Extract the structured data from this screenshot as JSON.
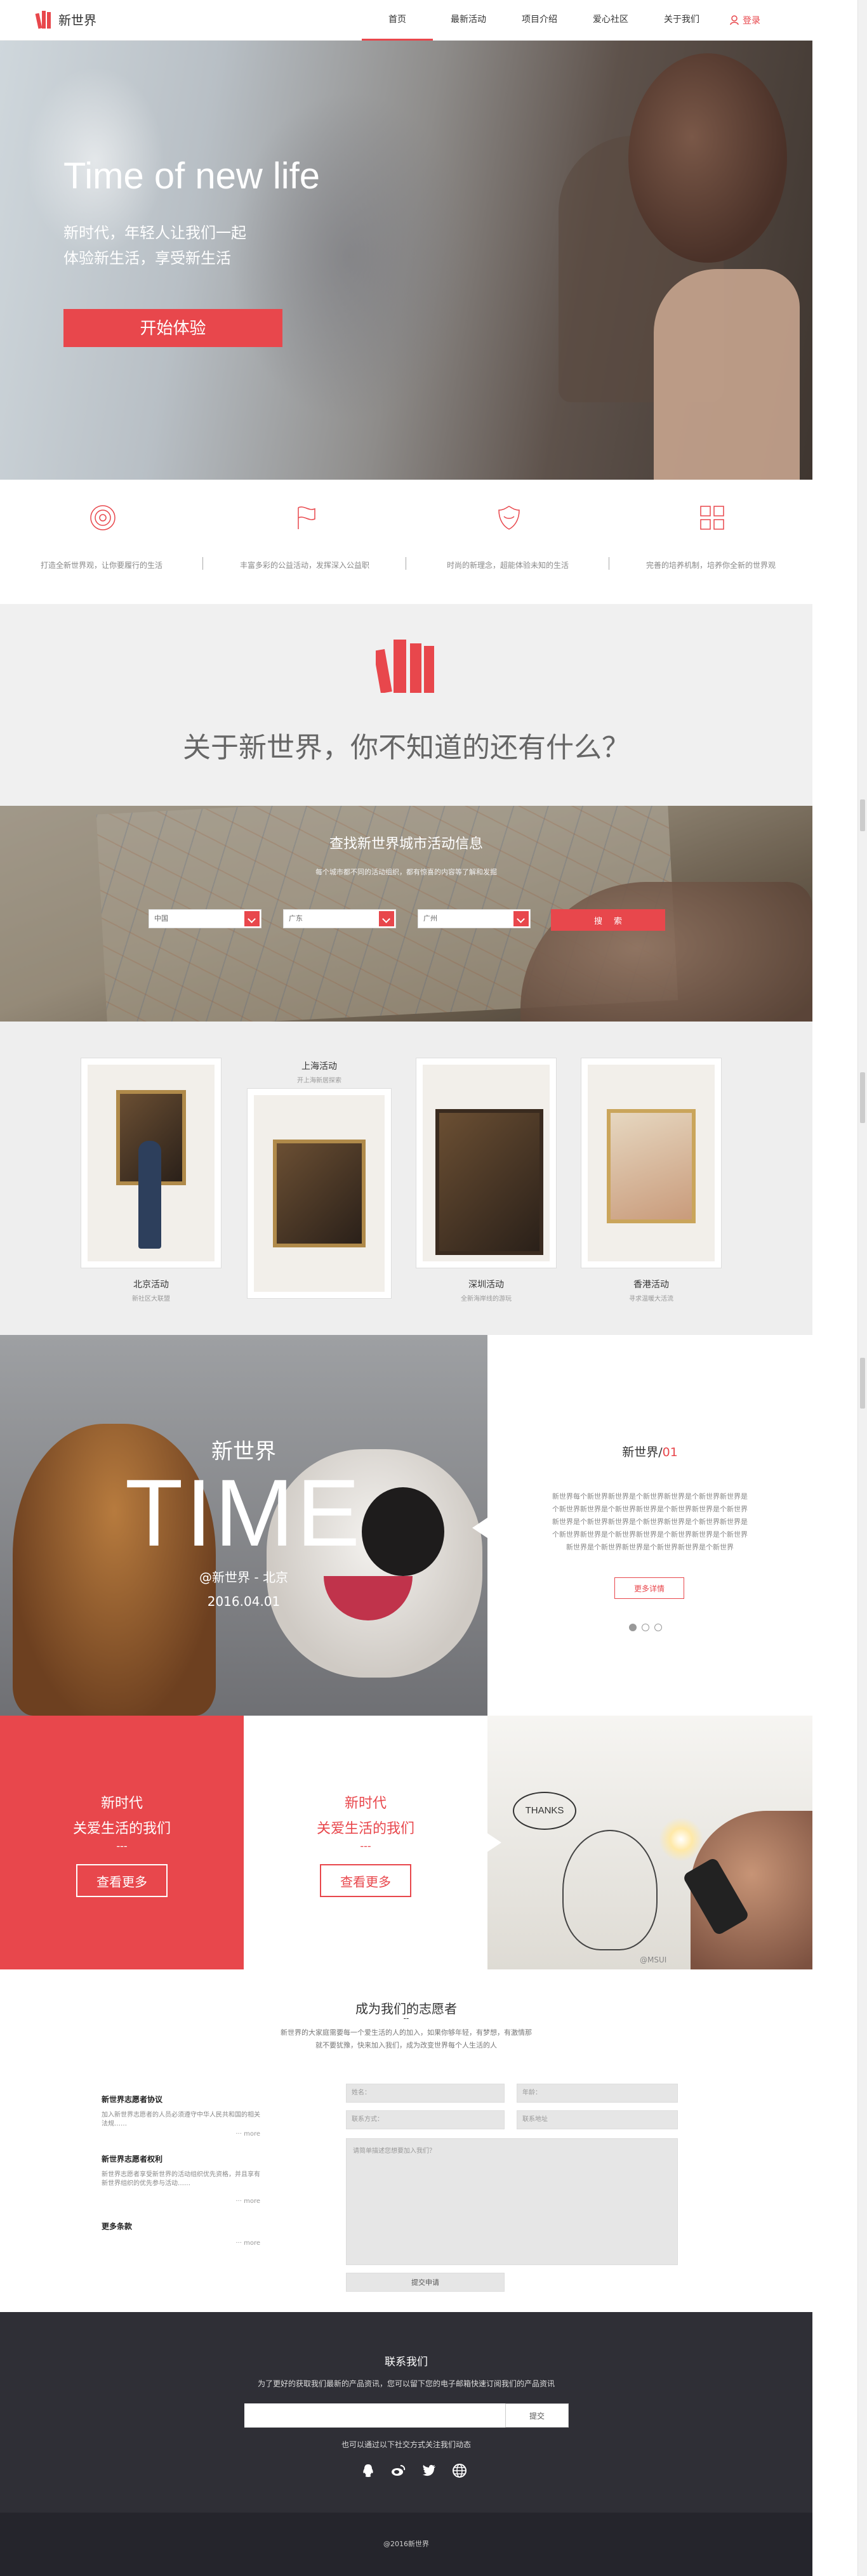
{
  "header": {
    "logo_text": "新世界",
    "nav": [
      "首页",
      "最新活动",
      "项目介绍",
      "爱心社区",
      "关于我们"
    ],
    "active_nav": 0,
    "login": "登录"
  },
  "hero": {
    "title": "Time of new life",
    "sub1": "新时代，年轻人让我们一起",
    "sub2": "体验新生活，享受新生活",
    "button": "开始体验"
  },
  "features": [
    {
      "icon": "target-icon",
      "text": "打造全新世界观，让你要履行的生活"
    },
    {
      "icon": "flag-icon",
      "text": "丰富多彩的公益活动，发挥深入公益职"
    },
    {
      "icon": "shield-icon",
      "text": "时尚的新理念，超能体验未知的生活"
    },
    {
      "icon": "grid-icon",
      "text": "完善的培养机制，培养你全新的世界观"
    }
  ],
  "about": {
    "title": "关于新世界，你不知道的还有什么？"
  },
  "search": {
    "title": "查找新世界城市活动信息",
    "subtitle": "每个城市都不同的活动组织，都有惊喜的内容等了解和发掘",
    "country": "中国",
    "province": "广东",
    "city": "广州",
    "button": "搜索"
  },
  "events": [
    {
      "title": "北京活动",
      "desc": "新社区大联盟"
    },
    {
      "title": "上海活动",
      "desc": "开上海新居探索"
    },
    {
      "title": "深圳活动",
      "desc": "全新海岸线的游玩"
    },
    {
      "title": "香港活动",
      "desc": "寻求温暖大活流"
    }
  ],
  "time": {
    "label": "新世界",
    "big": "TIME",
    "location": "@新世界 - 北京",
    "date": "2016.04.01",
    "panel_title": "新世界/",
    "panel_num": "01",
    "panel_body": "新世界每个新世界新世界是个新世界新世界是个新世界新世界是个新世界新世界是个新世界新世界是个新世界新世界是个新世界新世界是个新世界新世界是个新世界新世界是个新世界新世界是个新世界新世界是个新世界新世界是个新世界新世界是个新世界新世界是个新世界新世界是个新世界新世界是个新世界",
    "more": "更多详情"
  },
  "life": [
    {
      "line1": "新时代",
      "line2": "关爱生活的我们",
      "dash": "---",
      "button": "查看更多"
    },
    {
      "line1": "新时代",
      "line2": "关爱生活的我们",
      "dash": "---",
      "button": "查看更多"
    }
  ],
  "life_photo": {
    "bubble": "THANKS",
    "credit": "@MSUI"
  },
  "volunteer": {
    "title": "成为我们的志愿者",
    "dash": "--",
    "subtitle": "新世界的大家庭需要每一个爱生活的人的加入，如果你够年轻，有梦想，有激情那就不要犹豫，快来加入我们，成为改变世界每个人生活的人",
    "info": [
      {
        "title": "新世界志愿者协议",
        "body": "加入新世界志愿者的人员必须遵守中华人民共和国的相关法规……",
        "more": "more"
      },
      {
        "title": "新世界志愿者权利",
        "body": "新世界志愿者享受新世界的活动组织优先资格，并且享有新世界组织的优先参与活动……",
        "more": "more"
      },
      {
        "title": "更多条款",
        "body": "",
        "more": "more"
      }
    ],
    "name_ph": "姓名：",
    "age_ph": "年龄：",
    "contact_ph": "联系方式：",
    "addr_ph": "联系地址",
    "msg_ph": "请简单描述您想要加入我们？",
    "submit": "提交申请"
  },
  "contact": {
    "title": "联系我们",
    "subtitle": "为了更好的获取我们最新的产品资讯，您可以留下您的电子邮箱快速订阅我们的产品资讯",
    "submit": "提交",
    "note": "也可以通过以下社交方式关注我们动态"
  },
  "footer": {
    "copyright": "@2016新世界"
  }
}
